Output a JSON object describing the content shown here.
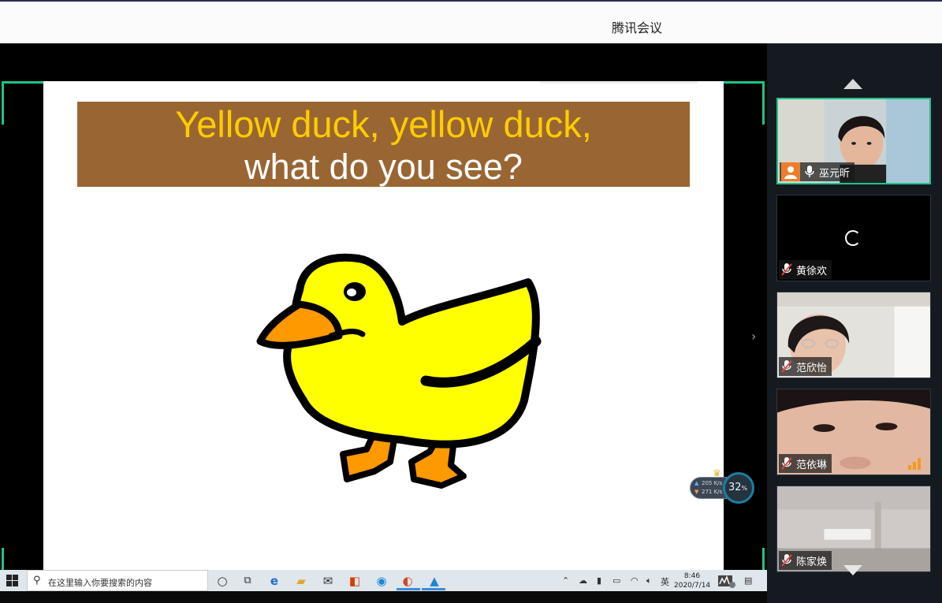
{
  "app": {
    "title": "腾讯会议"
  },
  "slide": {
    "title_line1": "Yellow duck, yellow duck,",
    "title_line2": "what do you see?",
    "banner_color": "#996633",
    "title_line1_color": "#ffcc00",
    "duck_color": "#ffff00",
    "beak_color": "#ff9900"
  },
  "net_widget": {
    "upload": "205 K/s",
    "download": "271 K/s",
    "cpu_percent": "32",
    "percent_sign": "%"
  },
  "taskbar": {
    "search_placeholder": "在这里输入你要搜索的内容",
    "ime": "英",
    "time": "8:46",
    "date": "2020/7/14"
  },
  "participants": [
    {
      "name": "巫元昕",
      "muted": false,
      "host": true,
      "video": "face-girl-1",
      "active": true
    },
    {
      "name": "黄徐欢",
      "muted": true,
      "video": "loading"
    },
    {
      "name": "范欣怡",
      "muted": true,
      "video": "face-girl-glasses"
    },
    {
      "name": "范依琳",
      "muted": true,
      "video": "face-closeup",
      "signal": "good"
    },
    {
      "name": "陈家焕",
      "muted": true,
      "video": "room-ceiling"
    }
  ],
  "accent_color": "#1fc28a"
}
